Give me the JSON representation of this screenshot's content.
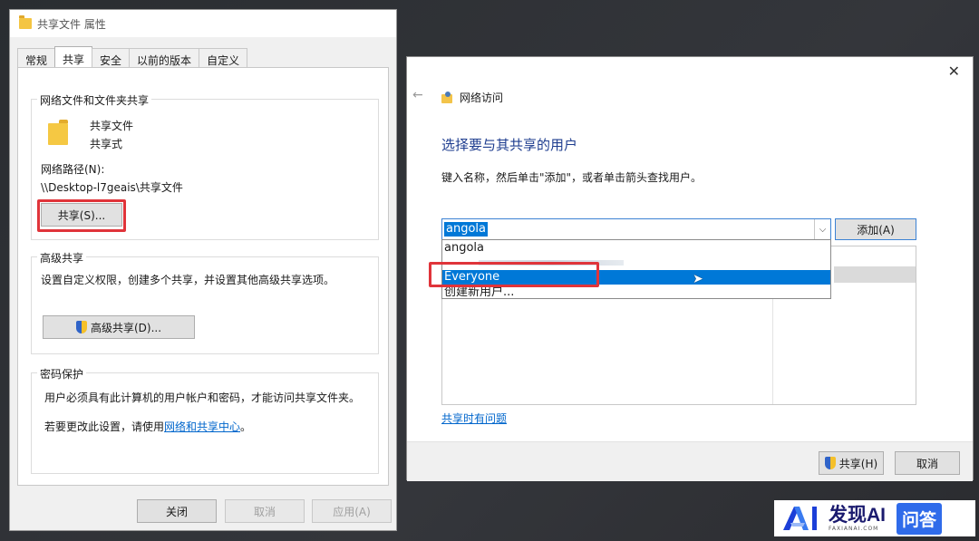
{
  "props_window": {
    "title": "共享文件 属性",
    "tabs": [
      {
        "label": "常规"
      },
      {
        "label": "共享"
      },
      {
        "label": "安全"
      },
      {
        "label": "以前的版本"
      },
      {
        "label": "自定义"
      }
    ],
    "active_tab": "共享",
    "network_share": {
      "group_title": "网络文件和文件夹共享",
      "folder_name": "共享文件",
      "status": "共享式",
      "path_label": "网络路径(N):",
      "path_value": "\\\\Desktop-l7geais\\共享文件",
      "share_button": "共享(S)..."
    },
    "advanced": {
      "group_title": "高级共享",
      "description": "设置自定义权限，创建多个共享，并设置其他高级共享选项。",
      "button": "高级共享(D)..."
    },
    "password": {
      "group_title": "密码保护",
      "line1": "用户必须具有此计算机的用户帐户和密码，才能访问共享文件夹。",
      "line2_prefix": "若要更改此设置，请使用",
      "line2_link": "网络和共享中心",
      "line2_suffix": "。"
    },
    "buttons": {
      "close": "关闭",
      "cancel": "取消",
      "apply": "应用(A)"
    }
  },
  "share_dialog": {
    "header": "网络访问",
    "heading": "选择要与其共享的用户",
    "instruction": "键入名称，然后单击\"添加\"，或者单击箭头查找用户。",
    "combo_value": "angola",
    "add_button": "添加(A)",
    "dropdown_items": [
      {
        "label": "angola"
      },
      {
        "label": "Everyone"
      },
      {
        "label": "创建新用户..."
      }
    ],
    "selected_item": "Everyone",
    "problem_link": "共享时有问题",
    "share_button": "共享(H)",
    "cancel_button": "取消"
  },
  "watermark": {
    "brand": "发现AI",
    "sub": "FAXIANAI.COM",
    "badge": "问答"
  },
  "colors": {
    "highlight": "#0078d7",
    "red_annotation": "#e0343a",
    "link": "#0066cc",
    "heading_blue": "#1e3d8f"
  }
}
